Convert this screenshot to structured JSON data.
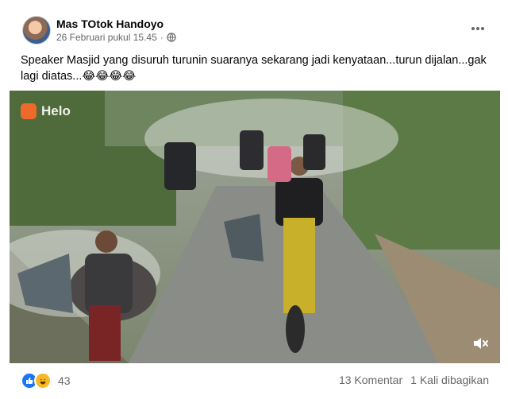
{
  "post": {
    "author": "Mas TOtok Handoyo",
    "timestamp": "26 Februari pukul 15.45",
    "privacy_icon": "globe-icon",
    "more_icon": "more-options-icon",
    "text": "Speaker Masjid yang disuruh turunin suaranya sekarang jadi kenyataan...turun dijalan...gak lagi diatas...😂😂😂😂"
  },
  "media": {
    "watermark": "Helo",
    "mute_icon": "speaker-muted-icon"
  },
  "footer": {
    "reaction_icons": [
      "like-icon",
      "haha-icon"
    ],
    "reaction_count": "43",
    "comments": "13 Komentar",
    "shares": "1 Kali dibagikan"
  },
  "colors": {
    "like": "#1877f2",
    "haha": "#f7b928",
    "secondary_text": "#65676b"
  }
}
